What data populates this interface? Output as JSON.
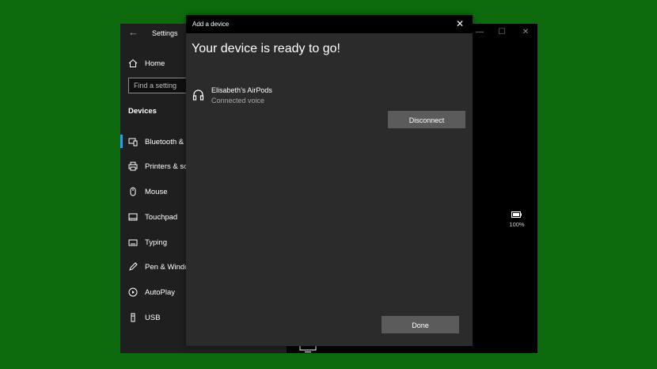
{
  "settings": {
    "title": "Settings",
    "home_label": "Home",
    "search_placeholder": "Find a setting",
    "section_title": "Devices",
    "nav": [
      {
        "label": "Bluetooth &",
        "icon": "bluetooth-devices-icon"
      },
      {
        "label": "Printers & sca",
        "icon": "printer-icon"
      },
      {
        "label": "Mouse",
        "icon": "mouse-icon"
      },
      {
        "label": "Touchpad",
        "icon": "touchpad-icon"
      },
      {
        "label": "Typing",
        "icon": "keyboard-icon"
      },
      {
        "label": "Pen & Windo",
        "icon": "pen-icon"
      },
      {
        "label": "AutoPlay",
        "icon": "autoplay-icon"
      },
      {
        "label": "USB",
        "icon": "usb-icon"
      }
    ],
    "battery_text": "100%"
  },
  "dialog": {
    "title": "Add a device",
    "heading": "Your device is ready to go!",
    "device": {
      "name": "Elisabeth’s AirPods",
      "status": "Connected voice",
      "icon": "headphones-icon"
    },
    "disconnect_label": "Disconnect",
    "done_label": "Done"
  },
  "colors": {
    "desktop": "#0d6b0d",
    "accent": "#3a96dd",
    "dialog_bg": "#2b2b2b",
    "button_bg": "#5b5b5b"
  }
}
